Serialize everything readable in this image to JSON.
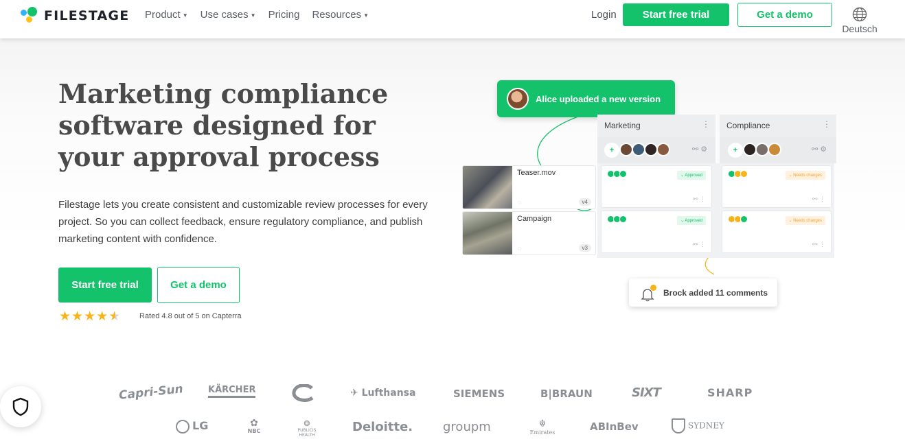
{
  "nav": {
    "logo_text": "FILESTAGE",
    "menu": [
      {
        "label": "Product",
        "has_caret": true
      },
      {
        "label": "Use cases",
        "has_caret": true
      },
      {
        "label": "Pricing",
        "has_caret": false
      },
      {
        "label": "Resources",
        "has_caret": true
      }
    ],
    "login": "Login",
    "trial_label": "Start free trial",
    "demo_label": "Get a demo",
    "language": "Deutsch"
  },
  "hero": {
    "title": "Marketing compliance software designed for your approval process",
    "description": "Filestage lets you create consistent and customizable review processes for every project. So you can collect feedback, ensure regulatory compliance, and publish marketing content with confidence.",
    "trial_label": "Start free trial",
    "demo_label": "Get a demo",
    "rating_value": 4.8,
    "rating_text": "Rated 4.8 out of 5 on Capterra"
  },
  "illustration": {
    "upload_toast": "Alice uploaded a new version",
    "columns": [
      {
        "name": "Marketing",
        "statuses": [
          "Approved",
          "Approved"
        ]
      },
      {
        "name": "Compliance",
        "statuses": [
          "Needs changes",
          "Needs changes"
        ]
      }
    ],
    "files": [
      {
        "name": "Teaser.mov",
        "version": "v4"
      },
      {
        "name": "Campaign",
        "version": "v3"
      }
    ],
    "comment_toast": "Brock added 11 comments"
  },
  "brands": {
    "row1": [
      "Capri-Sun",
      "KÄRCHER",
      "Chicago Bears",
      "Lufthansa",
      "SIEMENS",
      "B|BRAUN",
      "SIXT",
      "SHARP"
    ],
    "row2": [
      "LG",
      "NBC",
      "PUBLICIS HEALTH",
      "Deloitte.",
      "groupm",
      "Emirates",
      "ABInBev",
      "SYDNEY"
    ]
  },
  "colors": {
    "brand_green": "#14c26b",
    "accent_yellow": "#f8b31b",
    "accent_blue": "#2fb2ff"
  }
}
